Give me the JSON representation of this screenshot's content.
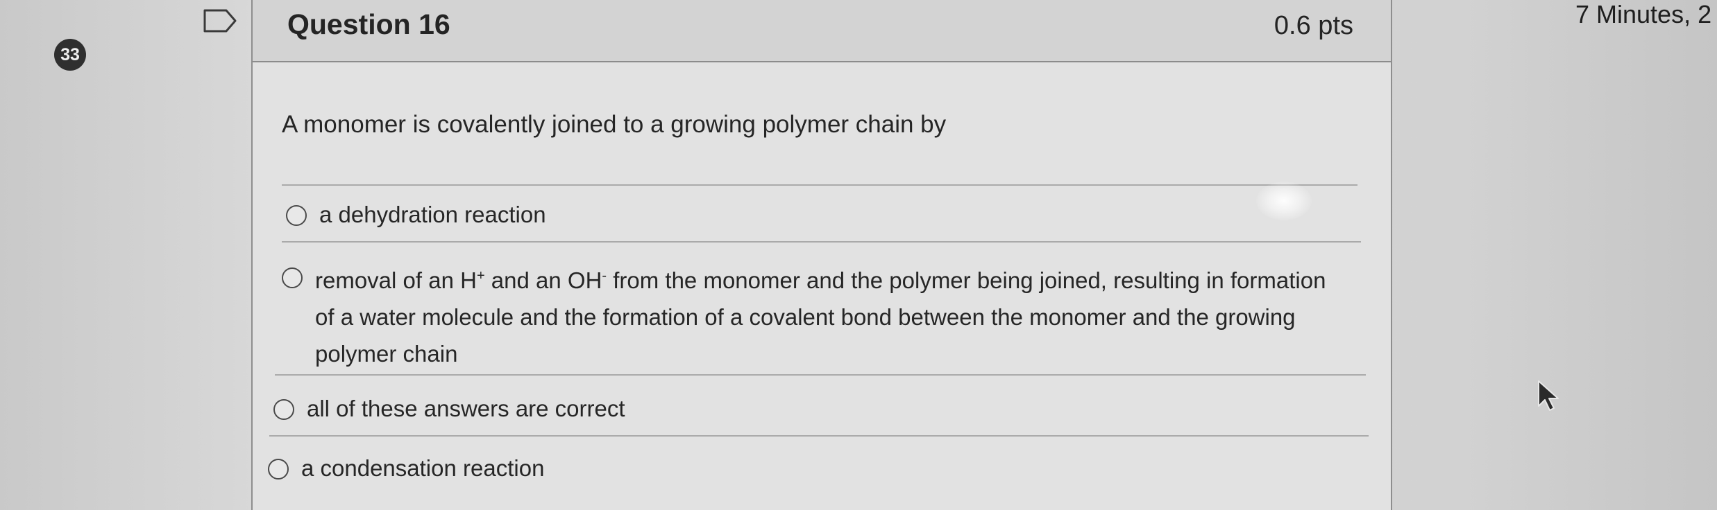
{
  "question_index_badge": "33",
  "timer_text": "7 Minutes, 2",
  "question": {
    "title": "Question 16",
    "points": "0.6 pts",
    "prompt": "A monomer is covalently joined to a growing polymer chain by"
  },
  "answers": [
    {
      "label": "a dehydration reaction"
    },
    {
      "label_part1": "removal of an H",
      "sup1": "+",
      "label_part2": " and an OH",
      "sup2": "-",
      "label_part3": " from the monomer and the polymer being joined, resulting in formation of a water molecule and the formation of a covalent bond between the monomer and the growing polymer chain"
    },
    {
      "label": "all of these answers are correct"
    },
    {
      "label": "a condensation reaction"
    }
  ],
  "icons": {
    "flag": "flag-bookmark-icon",
    "radio": "radio-button-icon",
    "cursor": "mouse-pointer-icon"
  },
  "colors": {
    "badge_bg": "#2f2f2f",
    "card_bg": "#e2e2e2",
    "header_bg": "#d3d3d3",
    "text": "#252525"
  }
}
